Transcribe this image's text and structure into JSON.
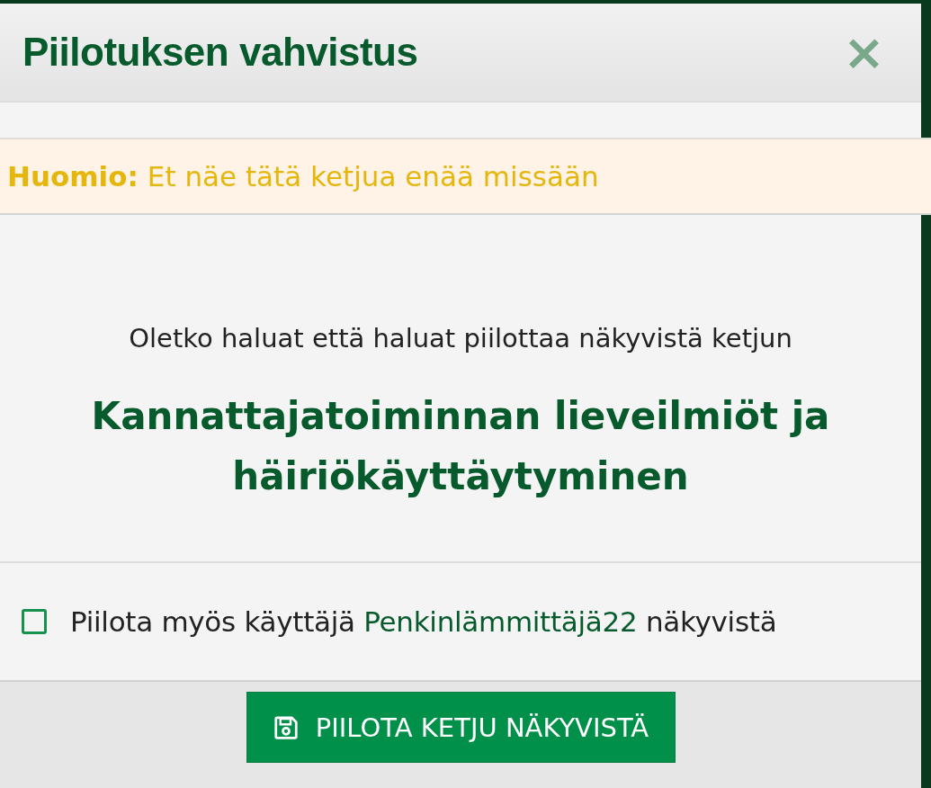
{
  "dialog": {
    "title": "Piilotuksen vahvistus",
    "close": "×"
  },
  "warning": "**Huomio:** Et näe tätä ketjua enää missään",
  "question": "Oletko haluat että haluat piilottaa näkyvistä ketjun",
  "thread_title": "Kannattajatoiminnan lieveilmiöt ja häiriökäyttäytyminen",
  "option": {
    "checked": false,
    "text_before": "Piilota myös käyttäjä",
    "username": "Penkinlämmittäjä22",
    "text_after": "näkyvistä"
  },
  "button": "PIILOTA KETJU NÄKYVISTÄ"
}
